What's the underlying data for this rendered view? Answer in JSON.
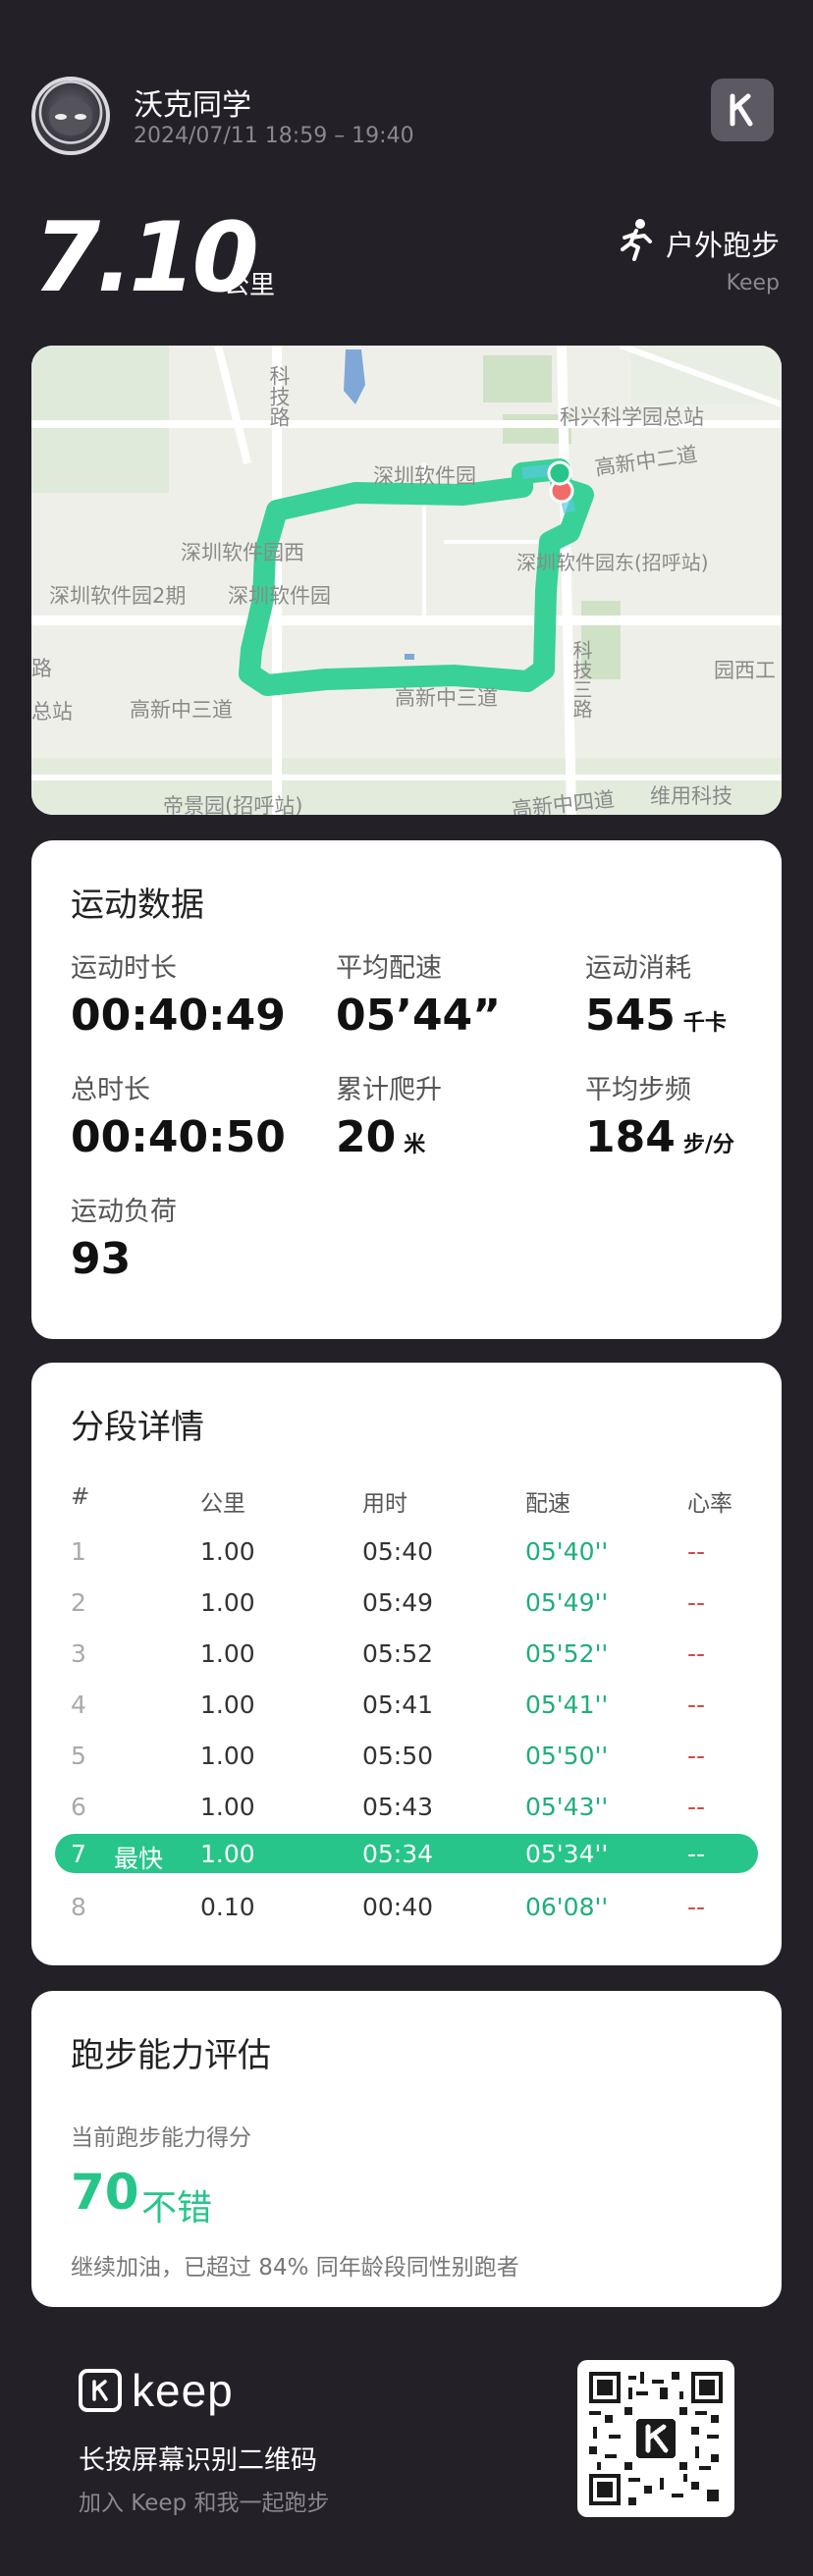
{
  "header": {
    "user_name": "沃克同学",
    "time_range": "2024/07/11 18:59 – 19:40",
    "brand_icon": "keep-k-icon"
  },
  "summary": {
    "distance": "7.10",
    "distance_unit": "公里",
    "sport_type": "户外跑步",
    "sport_icon": "runner-icon",
    "brand": "Keep"
  },
  "map": {
    "labels": {
      "keji_road": "科技路",
      "science_park": "科兴科学园总站",
      "software_park": "深圳软件园",
      "gaoxin_2": "高新中二道",
      "software_w": "深圳软件园西",
      "software_2": "深圳软件园2期",
      "software_center": "深圳软件园",
      "software_e": "深圳软件园东(招呼站)",
      "keji_3": "科技三路",
      "gaoxin_3a": "高新中三道",
      "gaoxin_3b": "高新中三道",
      "yuanxi": "园西工",
      "zongzhan": "总站",
      "dijing": "帝景园(招呼站)",
      "gaoxin_4": "高新中四道",
      "weiyong": "维用科技",
      "lu": "路"
    },
    "route_color": "#2ecf92"
  },
  "stats": {
    "title": "运动数据",
    "items": [
      {
        "label": "运动时长",
        "value": "00:40:49",
        "unit": ""
      },
      {
        "label": "平均配速",
        "value": "05’44”",
        "unit": ""
      },
      {
        "label": "运动消耗",
        "value": "545",
        "unit": "千卡"
      },
      {
        "label": "总时长",
        "value": "00:40:50",
        "unit": ""
      },
      {
        "label": "累计爬升",
        "value": "20",
        "unit": "米"
      },
      {
        "label": "平均步频",
        "value": "184",
        "unit": "步/分"
      },
      {
        "label": "运动负荷",
        "value": "93",
        "unit": ""
      }
    ]
  },
  "splits": {
    "title": "分段详情",
    "headers": [
      "#",
      "公里",
      "用时",
      "配速",
      "心率"
    ],
    "fastest_tag": "最快",
    "rows": [
      {
        "idx": "1",
        "km": "1.00",
        "time": "05:40",
        "pace": "05'40''",
        "hr": "--"
      },
      {
        "idx": "2",
        "km": "1.00",
        "time": "05:49",
        "pace": "05'49''",
        "hr": "--"
      },
      {
        "idx": "3",
        "km": "1.00",
        "time": "05:52",
        "pace": "05'52''",
        "hr": "--"
      },
      {
        "idx": "4",
        "km": "1.00",
        "time": "05:41",
        "pace": "05'41''",
        "hr": "--"
      },
      {
        "idx": "5",
        "km": "1.00",
        "time": "05:50",
        "pace": "05'50''",
        "hr": "--"
      },
      {
        "idx": "6",
        "km": "1.00",
        "time": "05:43",
        "pace": "05'43''",
        "hr": "--"
      },
      {
        "idx": "7",
        "km": "1.00",
        "time": "05:34",
        "pace": "05'34''",
        "hr": "--"
      },
      {
        "idx": "8",
        "km": "0.10",
        "time": "00:40",
        "pace": "06'08''",
        "hr": "--"
      }
    ]
  },
  "ability": {
    "title": "跑步能力评估",
    "subtitle": "当前跑步能力得分",
    "score": "70",
    "level": "不错",
    "note": "继续加油，已超过 84% 同年龄段同性别跑者"
  },
  "footer": {
    "logo_text": "keep",
    "line1": "长按屏幕识别二维码",
    "line2": "加入 Keep 和我一起跑步",
    "qr_icon": "qr-code-icon"
  },
  "colors": {
    "background": "#242028",
    "accent_green": "#27c58a",
    "heart_rate_red": "#d44848"
  }
}
